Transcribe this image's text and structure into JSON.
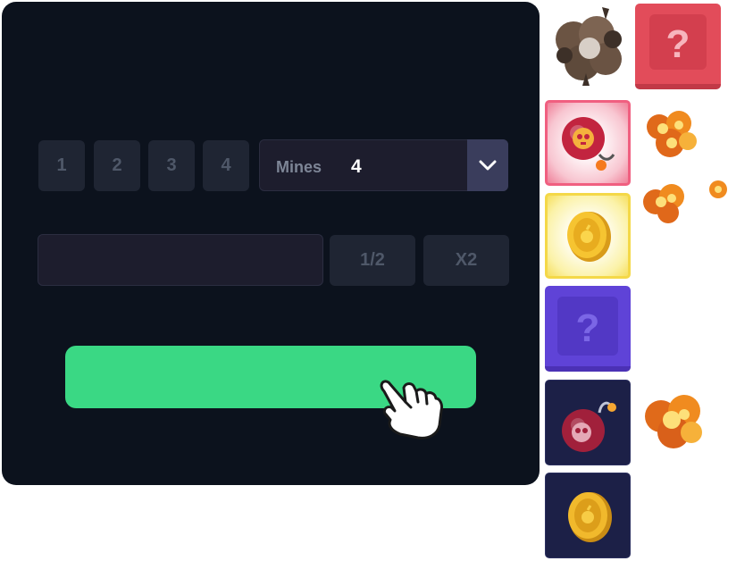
{
  "mines_options": [
    "1",
    "2",
    "3",
    "4"
  ],
  "mines_select": {
    "label": "Mines",
    "value": "4"
  },
  "bet": {
    "value": "",
    "half_label": "1/2",
    "double_label": "X2"
  },
  "play": {
    "label": ""
  },
  "tiles": [
    {
      "name": "hidden-tile-red",
      "symbol": "?"
    },
    {
      "name": "hidden-tile-purple",
      "symbol": "?"
    }
  ],
  "colors": {
    "panel_bg": "#0c121d",
    "button_bg": "#1f2533",
    "input_bg": "#1d1d2d",
    "play_green": "#3ad884",
    "tile_red": "#e24c5a",
    "tile_purple": "#5f43d7",
    "tile_navy": "#1c2047"
  },
  "icons": [
    "chevron-down-icon",
    "pointing-hand-icon",
    "bomb-icon",
    "coin-icon",
    "explosion-icon",
    "smoke-cloud-icon"
  ]
}
